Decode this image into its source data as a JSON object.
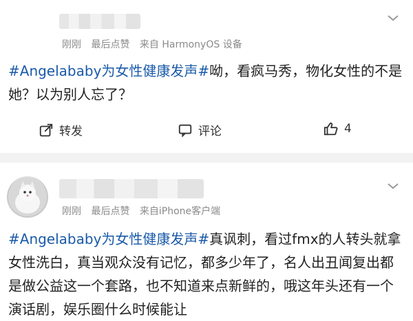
{
  "posts": [
    {
      "meta": {
        "time": "刚刚",
        "likes_recent": "最后点赞",
        "source": "来自 HarmonyOS 设备"
      },
      "text": {
        "hashtag": "#Angelababy为女性健康发声#",
        "content": "呦，看疯马秀，物化女性的不是她？以为别人忘了？"
      },
      "actions": {
        "repost": "转发",
        "comment": "评论",
        "like_count": "4"
      }
    },
    {
      "meta": {
        "time": "刚刚",
        "likes_recent": "最后点赞",
        "source": "来自iPhone客户端"
      },
      "text": {
        "hashtag": "#Angelababy为女性健康发声#",
        "content": "真讽刺，看过fmx的人转头就拿女性洗白，真当观众没有记忆，都多少年了，名人出丑闻复出都是做公益这一个套路，也不知道来点新鲜的，哦这年头还有一个演话剧，娱乐圈什么时候能让"
      }
    }
  ],
  "icons": {
    "chevron": "chevron-down-icon",
    "repost": "repost-icon",
    "comment": "comment-icon",
    "like": "thumbs-up-icon",
    "avatar": "cat-avatar"
  },
  "colors": {
    "hashtag": "#1a5aa8",
    "meta": "#8a8a8a",
    "separator": "#f2f2f2"
  }
}
